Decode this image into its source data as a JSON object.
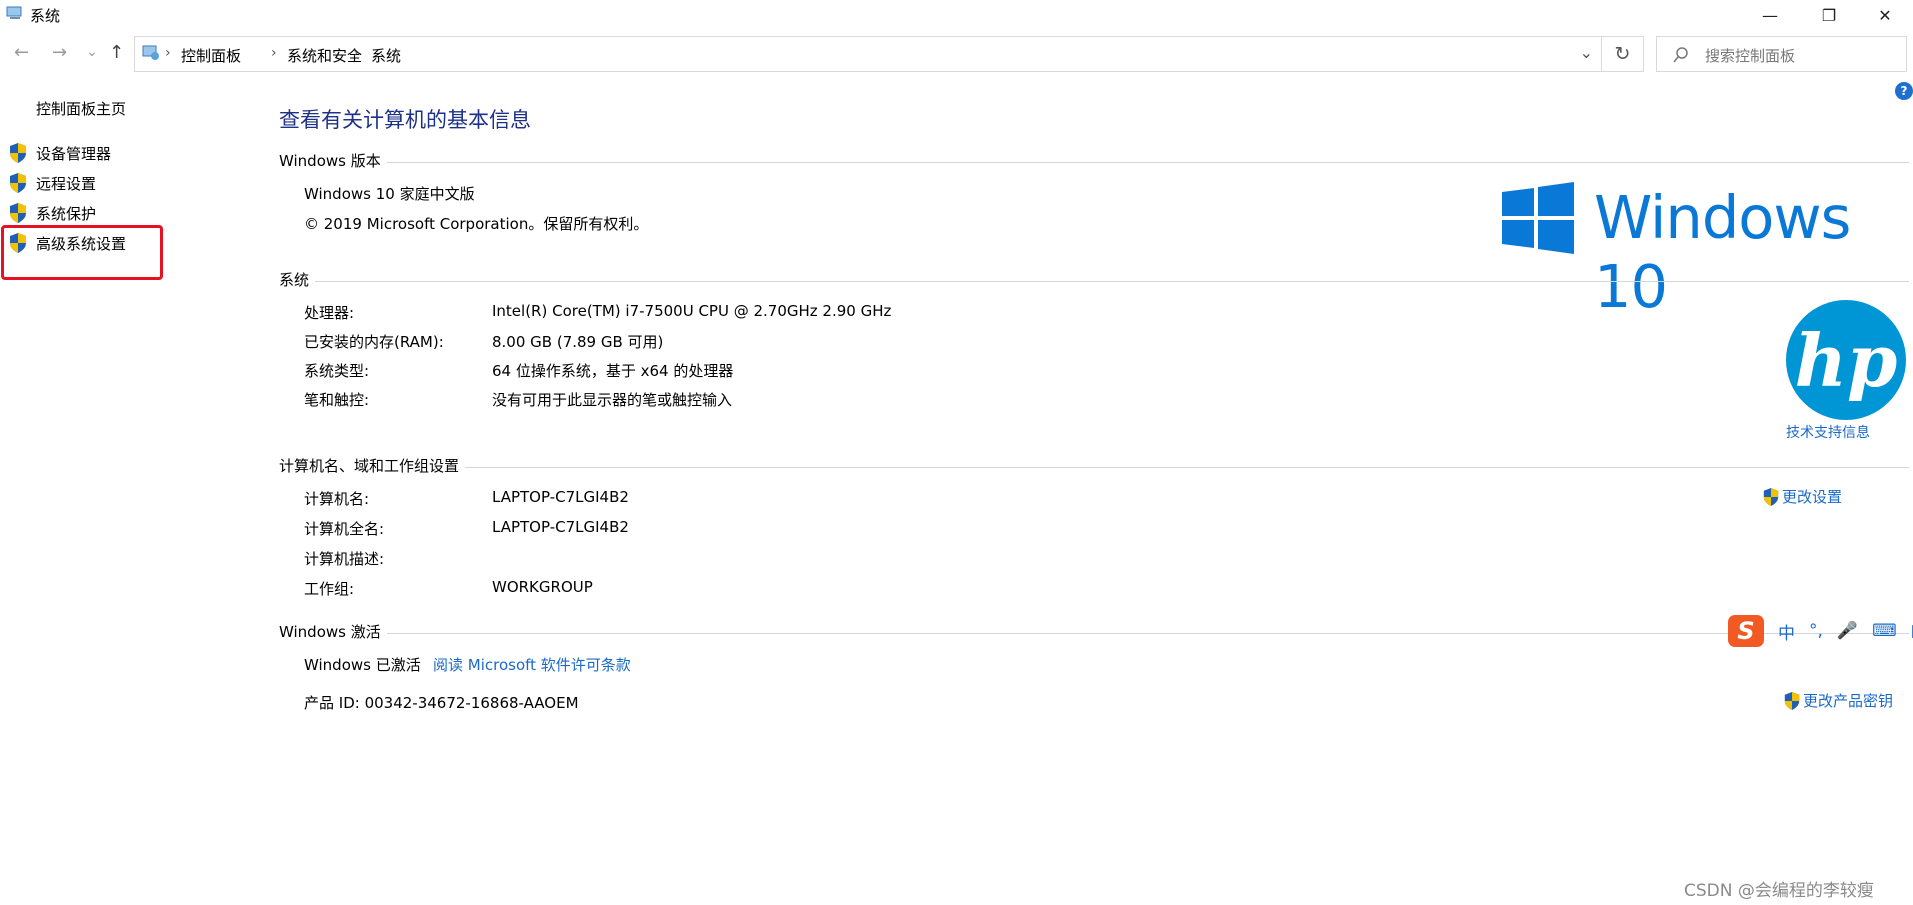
{
  "window": {
    "title": "系统",
    "minimize": "—",
    "restore": "❐",
    "close": "✕"
  },
  "nav": {
    "back": "←",
    "forward": "→",
    "recent": "⌄",
    "up": "↑",
    "breadcrumbs": [
      "控制面板",
      "系统和安全",
      "系统"
    ],
    "separator": "›",
    "dropdown": "⌄",
    "refresh": "↻",
    "search_placeholder": "搜索控制面板"
  },
  "sidebar": {
    "home": "控制面板主页",
    "items": [
      {
        "label": "设备管理器"
      },
      {
        "label": "远程设置"
      },
      {
        "label": "系统保护"
      },
      {
        "label": "高级系统设置"
      }
    ]
  },
  "main": {
    "title": "查看有关计算机的基本信息",
    "edition": {
      "header": "Windows 版本",
      "name": "Windows 10 家庭中文版",
      "copyright": "© 2019 Microsoft Corporation。保留所有权利。",
      "logo_text": "Windows 10"
    },
    "system": {
      "header": "系统",
      "rows": [
        {
          "label": "处理器:",
          "value": "Intel(R) Core(TM) i7-7500U CPU @ 2.70GHz   2.90 GHz"
        },
        {
          "label": "已安装的内存(RAM):",
          "value": "8.00 GB (7.89 GB 可用)"
        },
        {
          "label": "系统类型:",
          "value": "64 位操作系统，基于 x64 的处理器"
        },
        {
          "label": "笔和触控:",
          "value": "没有可用于此显示器的笔或触控输入"
        }
      ],
      "oem_logo": "hp",
      "support_link": "技术支持信息"
    },
    "computer": {
      "header": "计算机名、域和工作组设置",
      "rows": [
        {
          "label": "计算机名:",
          "value": "LAPTOP-C7LGI4B2"
        },
        {
          "label": "计算机全名:",
          "value": "LAPTOP-C7LGI4B2"
        },
        {
          "label": "计算机描述:",
          "value": ""
        },
        {
          "label": "工作组:",
          "value": "WORKGROUP"
        }
      ],
      "change_link": "更改设置"
    },
    "activation": {
      "header": "Windows 激活",
      "status": "Windows 已激活",
      "license_link": "阅读 Microsoft 软件许可条款",
      "product_id": "产品 ID: 00342-34672-16868-AAOEM",
      "change_key_link": "更改产品密钥"
    }
  },
  "ime": {
    "logo": "S",
    "lang": "中",
    "punct": "°,",
    "mic": "🎤",
    "keyboard": "⌨",
    "apps": "▦"
  },
  "help": "?",
  "watermark": "CSDN @会编程的李较瘦",
  "colors": {
    "accent": "#1e3287",
    "link": "#1b6ac9",
    "highlight": "#e81123",
    "windows_blue": "#0a78d7",
    "hp_blue": "#0096d6"
  }
}
